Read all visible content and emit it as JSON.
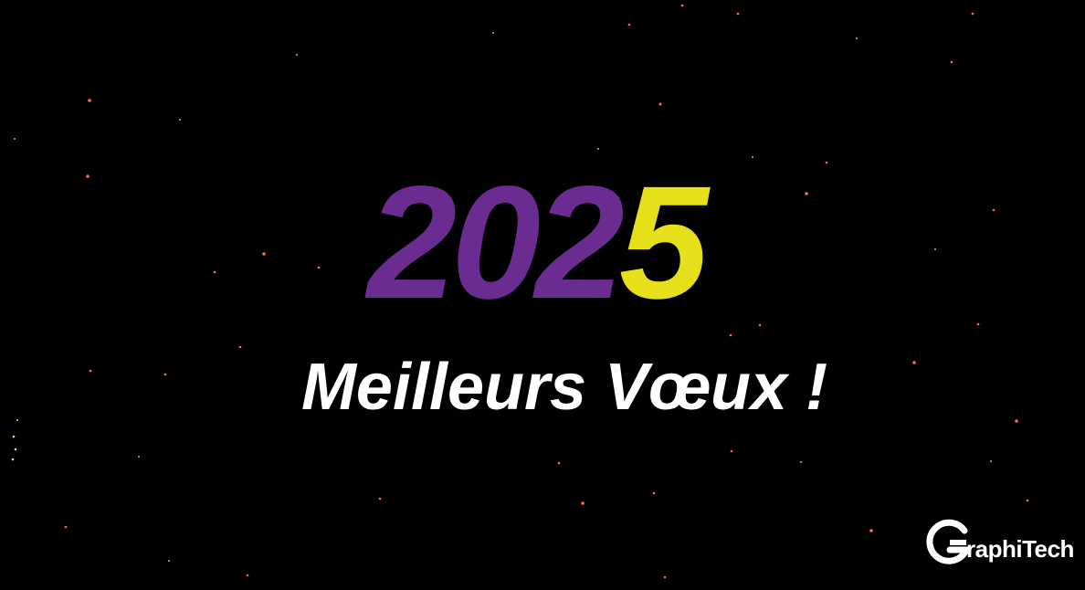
{
  "background_color": "#020101",
  "headline": {
    "year_part1": "202",
    "year_part2": "5",
    "year_part1_color": "#6b2c91",
    "year_part2_color": "#e5e01a"
  },
  "greeting": {
    "text": "Meilleurs Vœux !",
    "color": "#ffffff"
  },
  "logo": {
    "initial": "G",
    "rest": "raphiTech",
    "icon": "graphitech-g-logo-icon"
  },
  "decor": {
    "stars_icon": "starfield-icon",
    "star_color": "#ff6b5a"
  }
}
